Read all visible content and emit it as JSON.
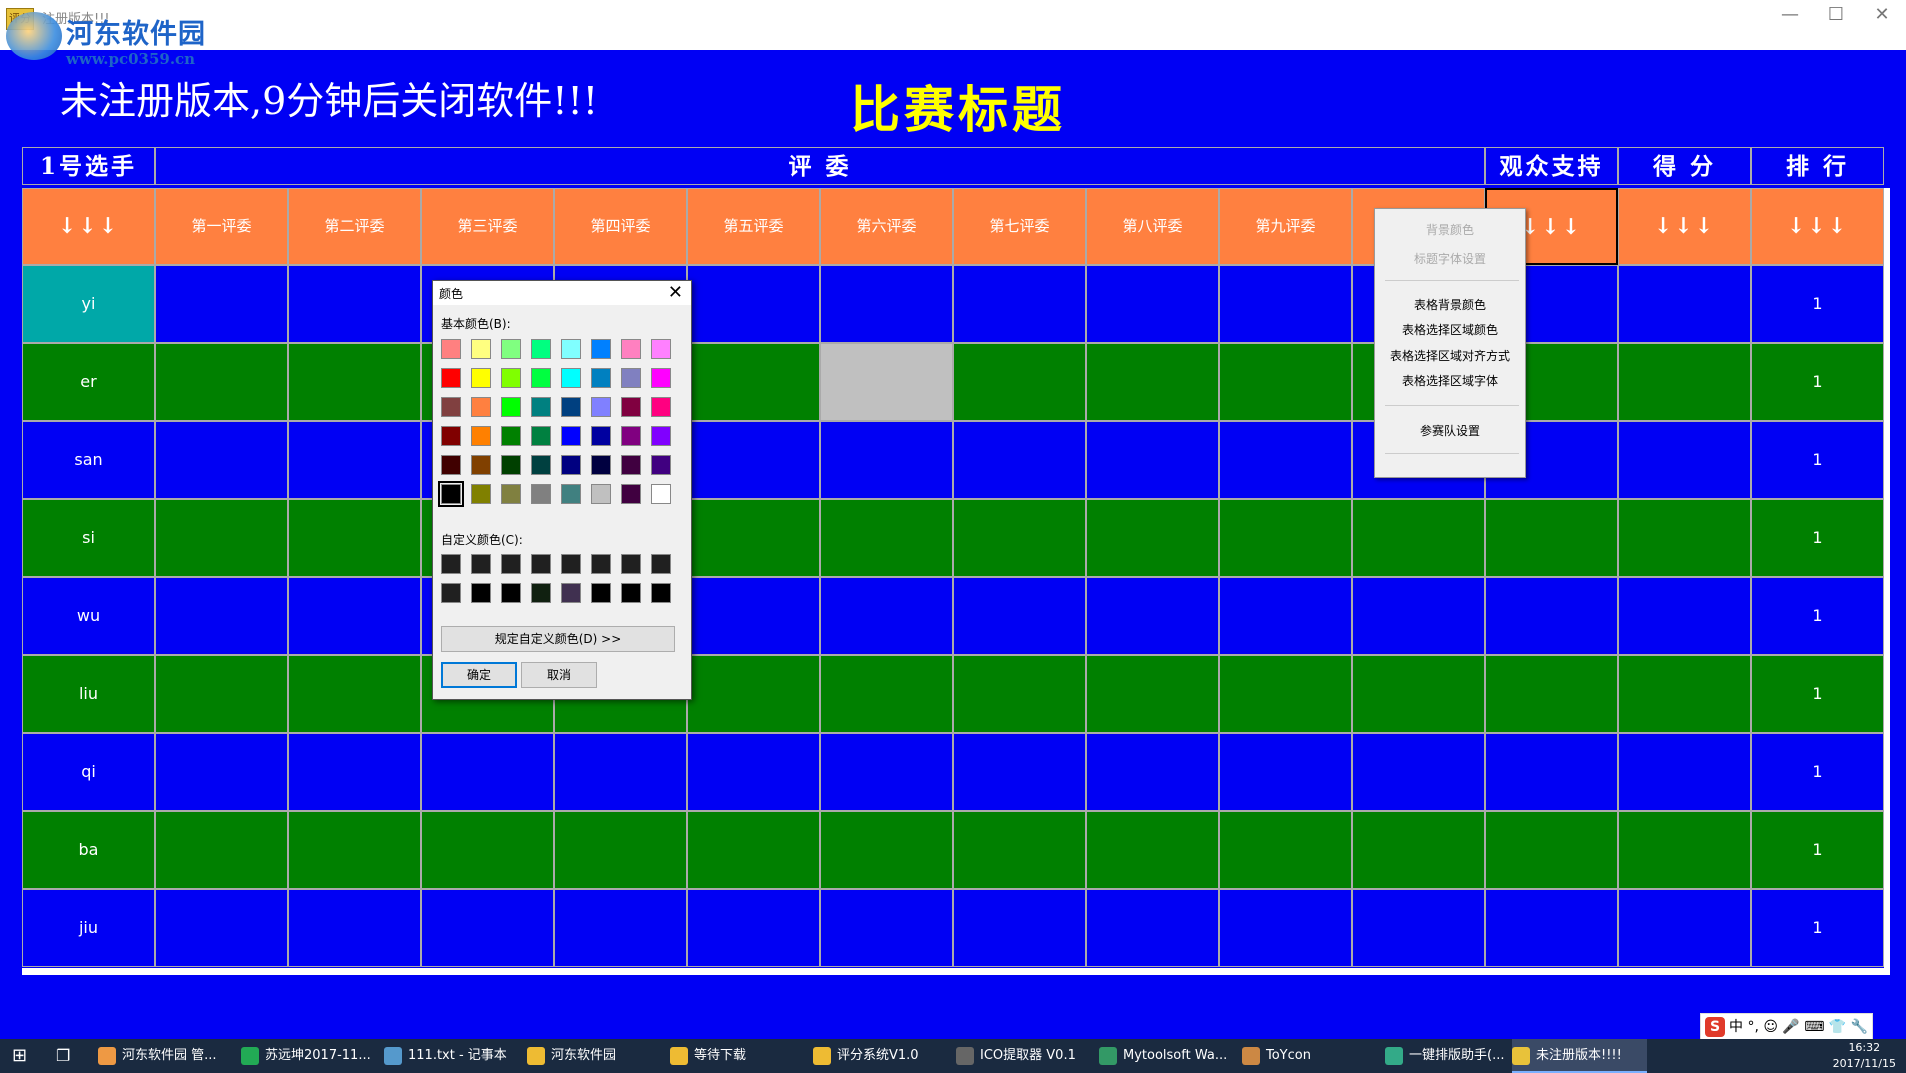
{
  "window": {
    "title": "注册版本!!!",
    "minimize": "—",
    "maximize": "☐",
    "close": "✕",
    "icon_text": "评分"
  },
  "watermark": {
    "name": "河东软件园",
    "url": "www.pc0359.cn"
  },
  "banner": {
    "warning": "未注册版本,9分钟后关闭软件!!!",
    "match_title": "比赛标题"
  },
  "header": {
    "player": "1号选手",
    "judges": "评 委",
    "audience": "观众支持",
    "score": "得 分",
    "rank": "排 行"
  },
  "columns": {
    "arrows": "↓↓↓",
    "judges": [
      "第一评委",
      "第二评委",
      "第三评委",
      "第四评委",
      "第五评委",
      "第六评委",
      "第七评委",
      "第八评委",
      "第九评委",
      ""
    ]
  },
  "rows": [
    {
      "name": "yi",
      "rank": "1"
    },
    {
      "name": "er",
      "rank": "1"
    },
    {
      "name": "san",
      "rank": "1"
    },
    {
      "name": "si",
      "rank": "1"
    },
    {
      "name": "wu",
      "rank": "1"
    },
    {
      "name": "liu",
      "rank": "1"
    },
    {
      "name": "qi",
      "rank": "1"
    },
    {
      "name": "ba",
      "rank": "1"
    },
    {
      "name": "jiu",
      "rank": "1"
    }
  ],
  "colors": {
    "blue": "#0000f4",
    "green": "#008000",
    "header_orange": "#ff8040",
    "name_teal": "#00a8a8",
    "selected_gray": "#c0c0c0",
    "title_yellow": "#ffff00"
  },
  "context_menu": {
    "items": [
      {
        "label": "背景颜色",
        "disabled": true
      },
      {
        "label": "标题字体设置",
        "disabled": true
      },
      {
        "label": "表格背景颜色",
        "disabled": false
      },
      {
        "label": "表格选择区域颜色",
        "disabled": false
      },
      {
        "label": "表格选择区域对齐方式",
        "disabled": false
      },
      {
        "label": "表格选择区域字体",
        "disabled": false
      },
      {
        "label": "参赛队设置",
        "disabled": false
      }
    ]
  },
  "color_dialog": {
    "title": "颜色",
    "basic_label": "基本颜色(B):",
    "custom_label": "自定义颜色(C):",
    "define_button": "规定自定义颜色(D) >>",
    "ok": "确定",
    "cancel": "取消",
    "basic_colors": [
      "#ff8080",
      "#ffff80",
      "#80ff80",
      "#00ff80",
      "#80ffff",
      "#0080ff",
      "#ff80c0",
      "#ff80ff",
      "#ff0000",
      "#ffff00",
      "#80ff00",
      "#00ff40",
      "#00ffff",
      "#0080c0",
      "#8080c0",
      "#ff00ff",
      "#804040",
      "#ff8040",
      "#00ff00",
      "#008080",
      "#004080",
      "#8080ff",
      "#800040",
      "#ff0080",
      "#800000",
      "#ff8000",
      "#008000",
      "#008040",
      "#0000ff",
      "#0000a0",
      "#800080",
      "#8000ff",
      "#400000",
      "#804000",
      "#004000",
      "#004040",
      "#000080",
      "#000040",
      "#400040",
      "#400080",
      "#000000",
      "#808000",
      "#808040",
      "#808080",
      "#408080",
      "#c0c0c0",
      "#400040",
      "#ffffff"
    ],
    "selected_basic": 40,
    "custom_colors": [
      "#202020",
      "#202020",
      "#202020",
      "#202020",
      "#202020",
      "#202020",
      "#202020",
      "#202020",
      "#202020",
      "#000000",
      "#000000",
      "#102010",
      "#403050",
      "#000000",
      "#000000",
      "#000000"
    ]
  },
  "ime": {
    "logo": "S",
    "text": "中 °, ☺ 🎤 ⌨ 👕 🔧"
  },
  "taskbar": {
    "items": [
      "河东软件园 管...",
      "苏远坤2017-11...",
      "111.txt - 记事本",
      "河东软件园",
      "等待下载",
      "评分系统V1.0",
      "ICO提取器 V0.1",
      "Mytoolsoft Wa...",
      "ToYcon",
      "一键排版助手(...",
      "未注册版本!!!!"
    ],
    "time": "16:32",
    "date": "2017/11/15"
  }
}
